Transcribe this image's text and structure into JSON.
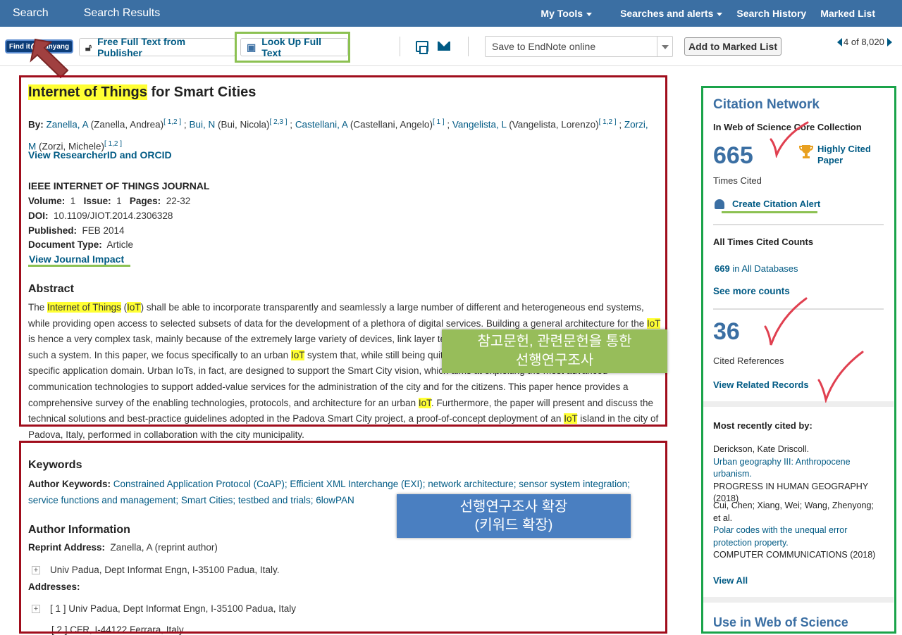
{
  "topnav": {
    "search": "Search",
    "results": "Search Results",
    "my_tools": "My Tools",
    "searches_alerts": "Searches and alerts",
    "history": "Search History",
    "marked_list": "Marked List"
  },
  "toolbar": {
    "find_it_left": "Find it",
    "find_it_right": "Hanyang",
    "free_full_text": "Free Full Text from Publisher",
    "look_up": "Look Up Full Text",
    "endnote": "Save to EndNote online",
    "add_marked": "Add to Marked List",
    "pager_current": "4",
    "pager_of": "of",
    "pager_total": "8,020"
  },
  "article": {
    "title_hl": "Internet of Things",
    "title_rest": " for Smart Cities",
    "by": "By:",
    "authors": [
      {
        "short": "Zanella, A",
        "full": "(Zanella, Andrea)",
        "sup": "[ 1,2 ]",
        "sep": " ;"
      },
      {
        "short": "Bui, N",
        "full": "(Bui, Nicola)",
        "sup": "[ 2,3 ]",
        "sep": " ;"
      },
      {
        "short": "Castellani, A",
        "full": "(Castellani, Angelo)",
        "sup": "[ 1 ]",
        "sep": " ;"
      },
      {
        "short": "Vangelista, L",
        "full": "(Vangelista, Lorenzo)",
        "sup": "[ 1,2 ]",
        "sep": " ;"
      },
      {
        "short": "Zorzi, M",
        "full": "(Zorzi, Michele)",
        "sup": "[ 1,2 ]",
        "sep": ""
      }
    ],
    "view_rid": "View ResearcherID and ORCID",
    "journal": "IEEE INTERNET OF THINGS JOURNAL",
    "volume_label": "Volume:",
    "volume": "1",
    "issue_label": "Issue:",
    "issue": "1",
    "pages_label": "Pages:",
    "pages": "22-32",
    "doi_label": "DOI:",
    "doi": "10.1109/JIOT.2014.2306328",
    "published_label": "Published:",
    "published": "FEB 2014",
    "doctype_label": "Document Type:",
    "doctype": "Article",
    "view_ji": "View Journal Impact",
    "abstract_heading": "Abstract",
    "abstract_parts": {
      "p1": "The ",
      "hl1": "Internet of Things",
      "p2": " (",
      "hl2": "IoT",
      "p3": ") shall be able to incorporate transparently and seamlessly a large number of different and heterogeneous end systems, while providing open access to selected subsets of data for the development of a plethora of digital services. Building a general architecture for the ",
      "hl3": "IoT",
      "p4": " is hence a very complex task, mainly because of the extremely large variety of devices, link layer technologies, and services that may be involved in such a system. In this paper, we focus specifically to an urban ",
      "hl4": "IoT",
      "p5": " system that, while still being quite a broad category, are characterized by their specific application domain. Urban IoTs, in fact, are designed to support the Smart City vision, which aims at exploiting the most advanced communication technologies to support added-value services for the administration of the city and for the citizens. This paper hence provides a comprehensive survey of the enabling technologies, protocols, and architecture for an urban ",
      "hl5": "IoT",
      "p6": ". Furthermore, the paper will present and discuss the technical solutions and best-practice guidelines adopted in the Padova Smart City project, a proof-of-concept deployment of an ",
      "hl6": "IoT",
      "p7": " island in the city of Padova, Italy, performed in collaboration with the city municipality."
    },
    "keywords_heading": "Keywords",
    "author_keywords_label": "Author Keywords:",
    "author_keywords": "Constrained Application Protocol (CoAP); Efficient XML Interchange (EXI); network architecture; sensor system integration; service functions and management; Smart Cities; testbed and trials; 6lowPAN",
    "author_info_heading": "Author Information",
    "reprint_label": "Reprint Address:",
    "reprint": "Zanella, A (reprint author)",
    "reprint_addr": "Univ Padua, Dept Informat Engn, I-35100 Padua, Italy.",
    "addresses_label": "Addresses:",
    "addr1": "[ 1 ] Univ Padua, Dept Informat Engn, I-35100 Padua, Italy",
    "addr2": "[ 2 ] CFR, I-44122 Ferrara, Italy"
  },
  "annotations": {
    "green_note_line1": "참고문헌, 관련문헌을 통한",
    "green_note_line2": "선행연구조사",
    "blue_note_line1": "선행연구조사 확장",
    "blue_note_line2": "(키워드 확장)"
  },
  "sidebar": {
    "title": "Citation Network",
    "sub": "In Web of Science Core Collection",
    "times_cited_num": "665",
    "times_cited_label": "Times Cited",
    "highly_cited": "Highly Cited Paper",
    "create_alert": "Create Citation Alert",
    "all_counts": "All Times Cited Counts",
    "all_db_num": "669",
    "all_db_label": " in All Databases",
    "see_more": "See more counts",
    "refs_num": "36",
    "refs_label": "Cited References",
    "related": "View Related Records",
    "recent_heading": "Most recently cited by:",
    "cite1_authors": "Derickson, Kate Driscoll.",
    "cite1_title": "Urban geography III: Anthropocene urbanism.",
    "cite1_source": "PROGRESS IN HUMAN GEOGRAPHY (2018)",
    "cite2_authors": "Cui, Chen; Xiang, Wei; Wang, Zhenyong; et al.",
    "cite2_title": "Polar codes with the unequal error protection property.",
    "cite2_source": "COMPUTER COMMUNICATIONS (2018)",
    "view_all": "View All",
    "use_wos": "Use in Web of Science"
  },
  "colors": {
    "nav": "#3b6fa3",
    "link": "#005a84",
    "highlight": "#ffff33",
    "red_frame": "#a00d1c",
    "green_frame": "#1aa34a",
    "green_note": "#97bd5a",
    "blue_note": "#4a7fc1"
  }
}
